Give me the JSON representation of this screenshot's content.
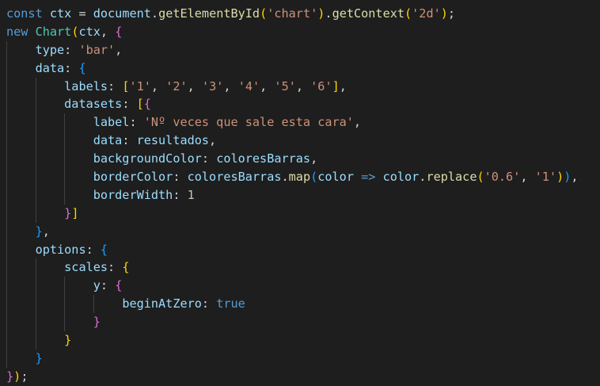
{
  "editor": {
    "colors": {
      "background": "#1e1e1e",
      "indent_guide": "#404040",
      "keyword": "#569cd6",
      "variable": "#9cdcfe",
      "function": "#dcdcaa",
      "class": "#4ec9b0",
      "string": "#ce9178",
      "number": "#b5cea8",
      "plain": "#d4d4d4",
      "bracket_gold": "#ffd700",
      "bracket_pink": "#da70d6",
      "bracket_blue": "#179fff"
    },
    "lines": [
      {
        "indent": 0,
        "tokens": [
          {
            "t": "const",
            "c": "keyword"
          },
          {
            "t": " "
          },
          {
            "t": "ctx",
            "c": "variable"
          },
          {
            "t": " = "
          },
          {
            "t": "document",
            "c": "variable"
          },
          {
            "t": "."
          },
          {
            "t": "getElementById",
            "c": "function"
          },
          {
            "t": "(",
            "c": "bracket_gold"
          },
          {
            "t": "'chart'",
            "c": "string"
          },
          {
            "t": ")",
            "c": "bracket_gold"
          },
          {
            "t": "."
          },
          {
            "t": "getContext",
            "c": "function"
          },
          {
            "t": "(",
            "c": "bracket_gold"
          },
          {
            "t": "'2d'",
            "c": "string"
          },
          {
            "t": ")",
            "c": "bracket_gold"
          },
          {
            "t": ";"
          }
        ]
      },
      {
        "indent": 0,
        "tokens": [
          {
            "t": "new",
            "c": "keyword"
          },
          {
            "t": " "
          },
          {
            "t": "Chart",
            "c": "class"
          },
          {
            "t": "(",
            "c": "bracket_gold"
          },
          {
            "t": "ctx",
            "c": "variable"
          },
          {
            "t": ", "
          },
          {
            "t": "{",
            "c": "bracket_pink"
          }
        ]
      },
      {
        "indent": 1,
        "tokens": [
          {
            "t": "type",
            "c": "variable"
          },
          {
            "t": ": "
          },
          {
            "t": "'bar'",
            "c": "string"
          },
          {
            "t": ","
          }
        ]
      },
      {
        "indent": 1,
        "tokens": [
          {
            "t": "data",
            "c": "variable"
          },
          {
            "t": ": "
          },
          {
            "t": "{",
            "c": "bracket_blue"
          }
        ]
      },
      {
        "indent": 2,
        "tokens": [
          {
            "t": "labels",
            "c": "variable"
          },
          {
            "t": ": "
          },
          {
            "t": "[",
            "c": "bracket_gold"
          },
          {
            "t": "'1'",
            "c": "string"
          },
          {
            "t": ", "
          },
          {
            "t": "'2'",
            "c": "string"
          },
          {
            "t": ", "
          },
          {
            "t": "'3'",
            "c": "string"
          },
          {
            "t": ", "
          },
          {
            "t": "'4'",
            "c": "string"
          },
          {
            "t": ", "
          },
          {
            "t": "'5'",
            "c": "string"
          },
          {
            "t": ", "
          },
          {
            "t": "'6'",
            "c": "string"
          },
          {
            "t": "]",
            "c": "bracket_gold"
          },
          {
            "t": ","
          }
        ]
      },
      {
        "indent": 2,
        "tokens": [
          {
            "t": "datasets",
            "c": "variable"
          },
          {
            "t": ": "
          },
          {
            "t": "[",
            "c": "bracket_gold"
          },
          {
            "t": "{",
            "c": "bracket_pink"
          }
        ]
      },
      {
        "indent": 3,
        "tokens": [
          {
            "t": "label",
            "c": "variable"
          },
          {
            "t": ": "
          },
          {
            "t": "'Nº veces que sale esta cara'",
            "c": "string"
          },
          {
            "t": ","
          }
        ]
      },
      {
        "indent": 3,
        "tokens": [
          {
            "t": "data",
            "c": "variable"
          },
          {
            "t": ": "
          },
          {
            "t": "resultados",
            "c": "variable"
          },
          {
            "t": ","
          }
        ]
      },
      {
        "indent": 3,
        "tokens": [
          {
            "t": "backgroundColor",
            "c": "variable"
          },
          {
            "t": ": "
          },
          {
            "t": "coloresBarras",
            "c": "variable"
          },
          {
            "t": ","
          }
        ]
      },
      {
        "indent": 3,
        "tokens": [
          {
            "t": "borderColor",
            "c": "variable"
          },
          {
            "t": ": "
          },
          {
            "t": "coloresBarras",
            "c": "variable"
          },
          {
            "t": "."
          },
          {
            "t": "map",
            "c": "function"
          },
          {
            "t": "(",
            "c": "bracket_blue"
          },
          {
            "t": "color",
            "c": "variable"
          },
          {
            "t": " "
          },
          {
            "t": "=>",
            "c": "keyword"
          },
          {
            "t": " "
          },
          {
            "t": "color",
            "c": "variable"
          },
          {
            "t": "."
          },
          {
            "t": "replace",
            "c": "function"
          },
          {
            "t": "(",
            "c": "bracket_gold"
          },
          {
            "t": "'0.6'",
            "c": "string"
          },
          {
            "t": ", "
          },
          {
            "t": "'1'",
            "c": "string"
          },
          {
            "t": ")",
            "c": "bracket_gold"
          },
          {
            "t": ")",
            "c": "bracket_blue"
          },
          {
            "t": ","
          }
        ]
      },
      {
        "indent": 3,
        "tokens": [
          {
            "t": "borderWidth",
            "c": "variable"
          },
          {
            "t": ": "
          },
          {
            "t": "1",
            "c": "number"
          }
        ]
      },
      {
        "indent": 2,
        "tokens": [
          {
            "t": "}",
            "c": "bracket_pink"
          },
          {
            "t": "]",
            "c": "bracket_gold"
          }
        ]
      },
      {
        "indent": 1,
        "tokens": [
          {
            "t": "}",
            "c": "bracket_blue"
          },
          {
            "t": ","
          }
        ]
      },
      {
        "indent": 1,
        "tokens": [
          {
            "t": "options",
            "c": "variable"
          },
          {
            "t": ": "
          },
          {
            "t": "{",
            "c": "bracket_blue"
          }
        ]
      },
      {
        "indent": 2,
        "tokens": [
          {
            "t": "scales",
            "c": "variable"
          },
          {
            "t": ": "
          },
          {
            "t": "{",
            "c": "bracket_gold"
          }
        ]
      },
      {
        "indent": 3,
        "tokens": [
          {
            "t": "y",
            "c": "variable"
          },
          {
            "t": ": "
          },
          {
            "t": "{",
            "c": "bracket_pink"
          }
        ]
      },
      {
        "indent": 4,
        "tokens": [
          {
            "t": "beginAtZero",
            "c": "variable"
          },
          {
            "t": ": "
          },
          {
            "t": "true",
            "c": "keyword"
          }
        ]
      },
      {
        "indent": 3,
        "tokens": [
          {
            "t": "}",
            "c": "bracket_pink"
          }
        ]
      },
      {
        "indent": 2,
        "tokens": [
          {
            "t": "}",
            "c": "bracket_gold"
          }
        ]
      },
      {
        "indent": 1,
        "tokens": [
          {
            "t": "}",
            "c": "bracket_blue"
          }
        ]
      },
      {
        "indent": 0,
        "tokens": [
          {
            "t": "}",
            "c": "bracket_pink"
          },
          {
            "t": ")",
            "c": "bracket_gold"
          },
          {
            "t": ";"
          }
        ]
      }
    ]
  }
}
